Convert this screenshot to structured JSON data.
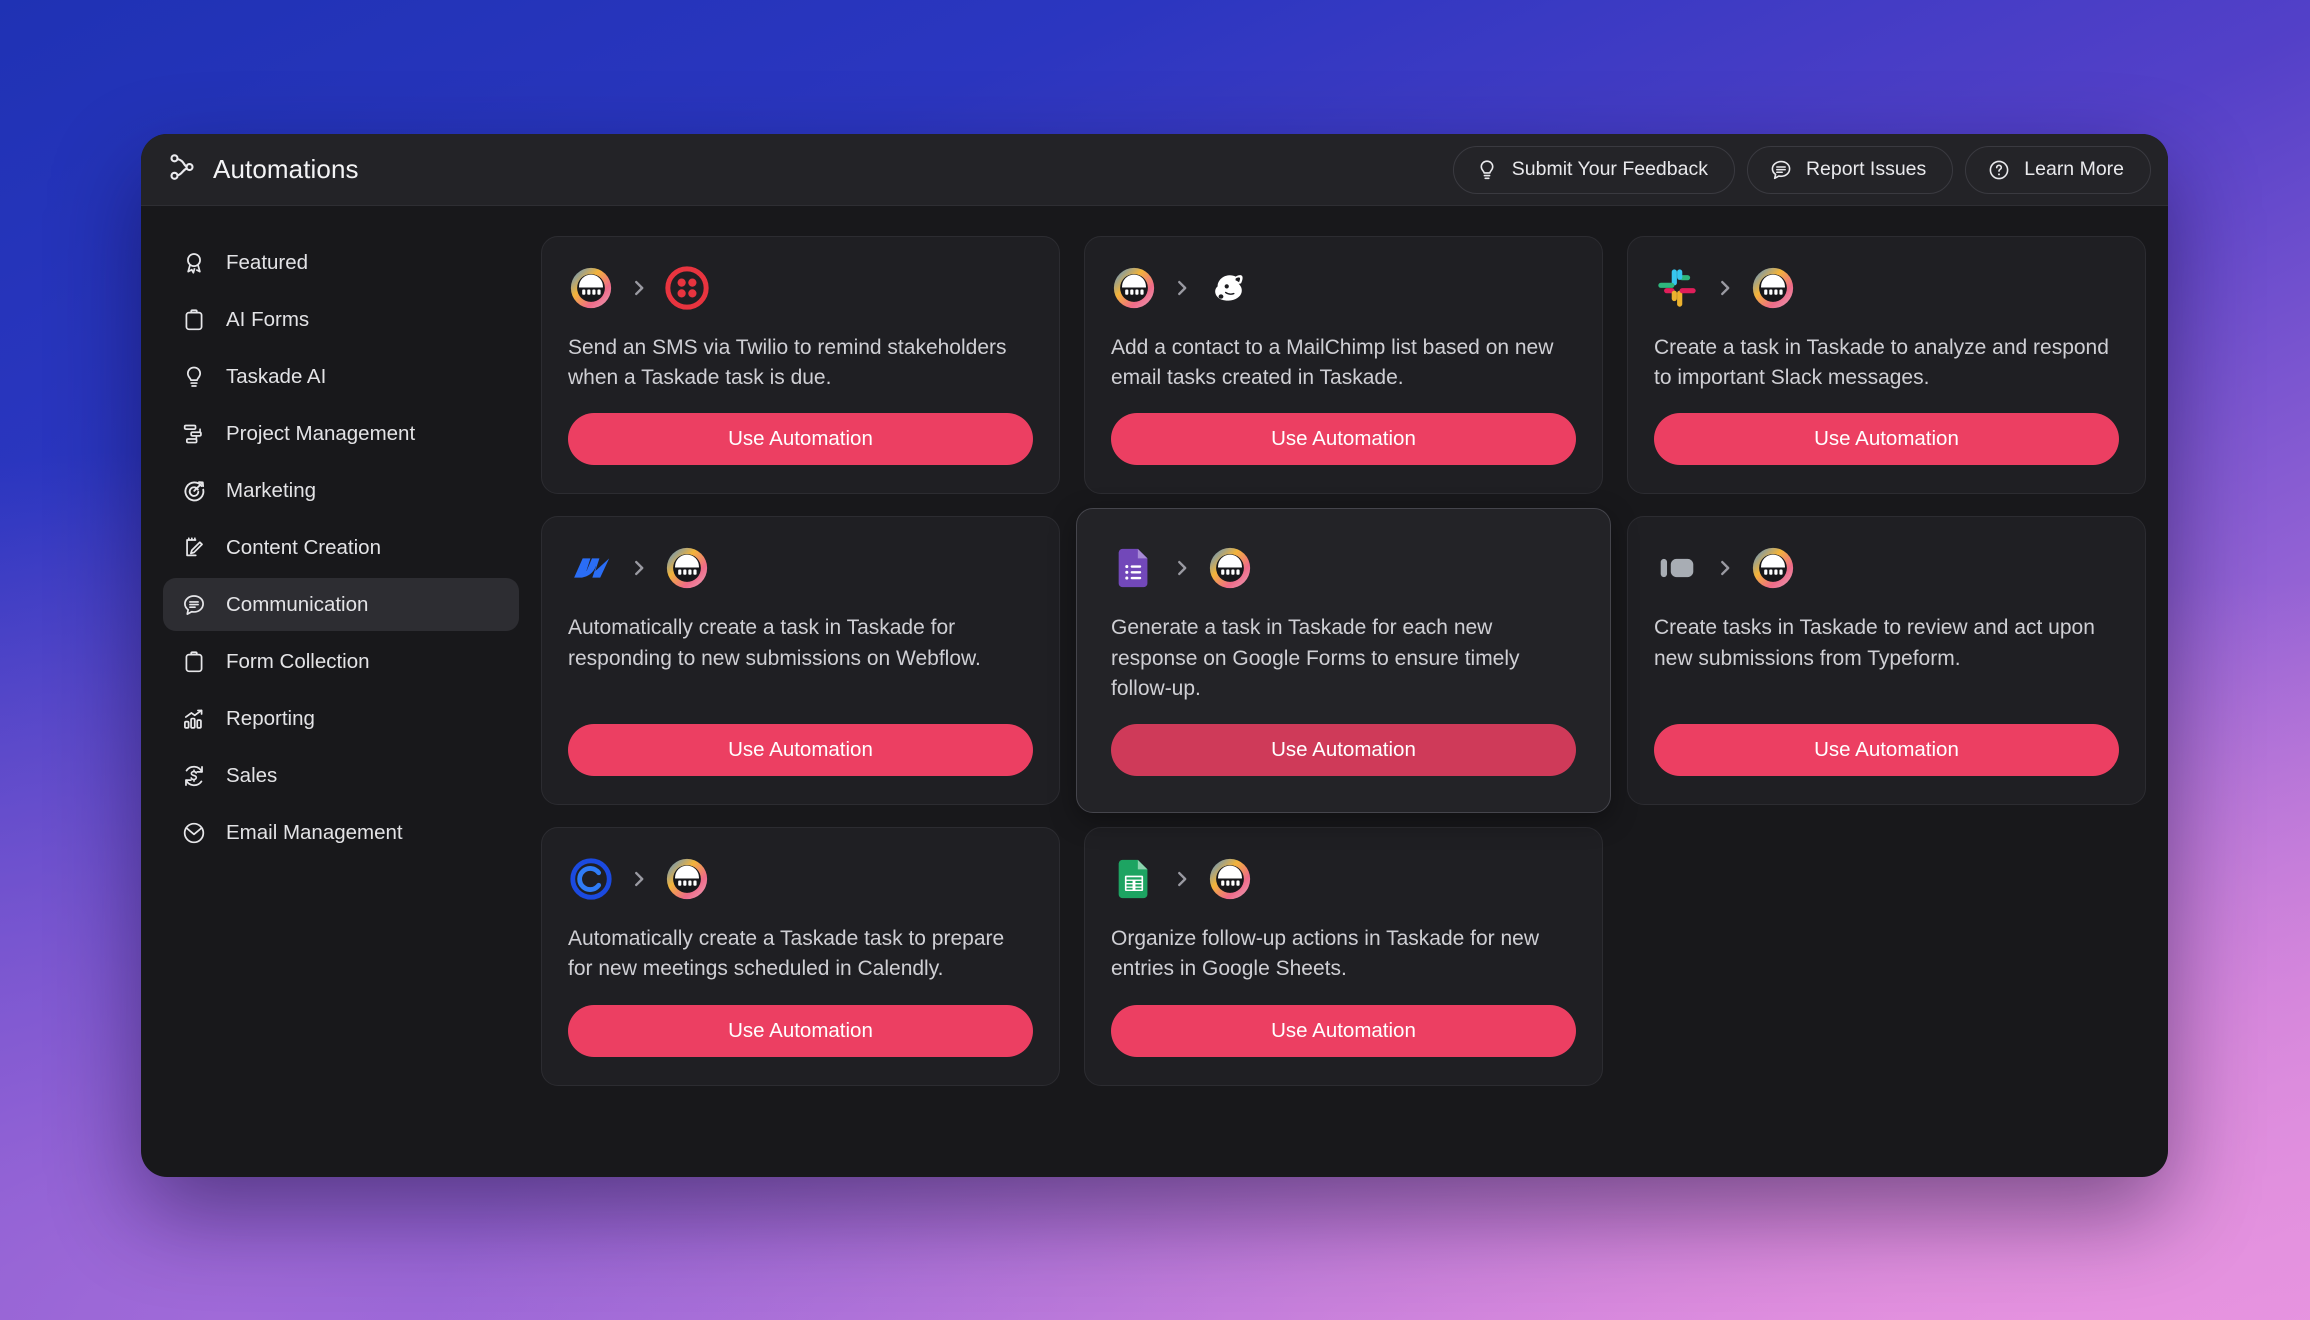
{
  "theme": {
    "accent": "#ec3f62",
    "accent_pressed": "#cf3a59",
    "window_bg": "#18181b",
    "card_bg": "#1f1f23",
    "titlebar_bg": "#232327",
    "background_gradient_start": "#1f32b4",
    "background_gradient_end": "#dd90dc"
  },
  "header": {
    "title": "Automations",
    "title_icon": "automation-flow-icon",
    "actions": [
      {
        "label": "Submit Your Feedback",
        "icon": "lightbulb-icon"
      },
      {
        "label": "Report Issues",
        "icon": "comment-lines-icon"
      },
      {
        "label": "Learn More",
        "icon": "question-circle-icon"
      }
    ]
  },
  "sidebar": {
    "items": [
      {
        "label": "Featured",
        "icon": "award-ribbon-icon",
        "active": false
      },
      {
        "label": "AI Forms",
        "icon": "clipboard-icon",
        "active": false
      },
      {
        "label": "Taskade AI",
        "icon": "lightbulb-icon",
        "active": false
      },
      {
        "label": "Project Management",
        "icon": "gantt-chart-icon",
        "active": false
      },
      {
        "label": "Marketing",
        "icon": "target-arrow-icon",
        "active": false
      },
      {
        "label": "Content Creation",
        "icon": "note-pencil-icon",
        "active": false
      },
      {
        "label": "Communication",
        "icon": "chat-bubble-icon",
        "active": true
      },
      {
        "label": "Form Collection",
        "icon": "clipboard-icon",
        "active": false
      },
      {
        "label": "Reporting",
        "icon": "bar-chart-up-icon",
        "active": false
      },
      {
        "label": "Sales",
        "icon": "dollar-refresh-icon",
        "active": false
      },
      {
        "label": "Email Management",
        "icon": "envelope-clock-icon",
        "active": false
      }
    ]
  },
  "main": {
    "button_label": "Use Automation",
    "cards": [
      {
        "source_icon": "taskade-icon",
        "target_icon": "twilio-icon",
        "description": "Send an SMS via Twilio to remind stakeholders when a Taskade task is due.",
        "hovered": false
      },
      {
        "source_icon": "taskade-icon",
        "target_icon": "mailchimp-icon",
        "description": "Add a contact to a MailChimp list based on new email tasks created in Taskade.",
        "hovered": false
      },
      {
        "source_icon": "slack-icon",
        "target_icon": "taskade-icon",
        "description": "Create a task in Taskade to analyze and respond to important Slack messages.",
        "hovered": false
      },
      {
        "source_icon": "webflow-icon",
        "target_icon": "taskade-icon",
        "description": "Automatically create a task in Taskade for responding to new submissions on Webflow.",
        "hovered": false
      },
      {
        "source_icon": "google-forms-icon",
        "target_icon": "taskade-icon",
        "description": "Generate a task in Taskade for each new response on Google Forms to ensure timely follow-up.",
        "hovered": true
      },
      {
        "source_icon": "typeform-icon",
        "target_icon": "taskade-icon",
        "description": "Create tasks in Taskade to review and act upon new submissions from Typeform.",
        "hovered": false
      },
      {
        "source_icon": "calendly-icon",
        "target_icon": "taskade-icon",
        "description": "Automatically create a Taskade task to prepare for new meetings scheduled in Calendly.",
        "hovered": false
      },
      {
        "source_icon": "google-sheets-icon",
        "target_icon": "taskade-icon",
        "description": "Organize follow-up actions in Taskade for new entries in Google Sheets.",
        "hovered": false
      }
    ]
  }
}
